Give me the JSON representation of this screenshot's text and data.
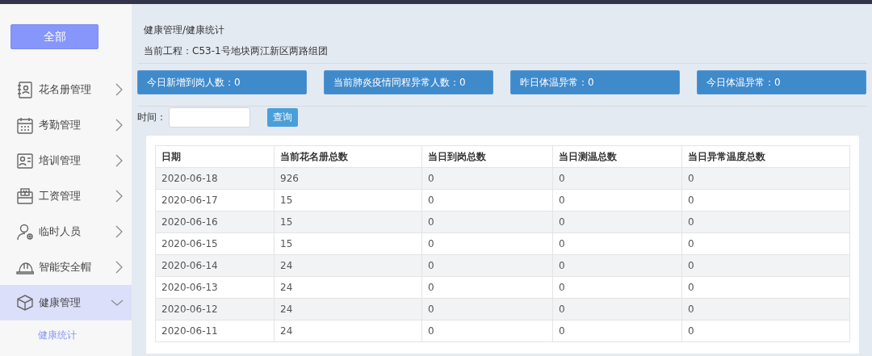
{
  "sidebar": {
    "all_button": "全部",
    "items": [
      {
        "label": "花名册管理",
        "expanded": false,
        "selected": false
      },
      {
        "label": "考勤管理",
        "expanded": false,
        "selected": false
      },
      {
        "label": "培训管理",
        "expanded": false,
        "selected": false
      },
      {
        "label": "工资管理",
        "expanded": false,
        "selected": false
      },
      {
        "label": "临时人员",
        "expanded": false,
        "selected": false
      },
      {
        "label": "智能安全帽",
        "expanded": false,
        "selected": false
      },
      {
        "label": "健康管理",
        "expanded": true,
        "selected": true,
        "children": [
          {
            "label": "健康统计",
            "selected": true
          }
        ]
      }
    ]
  },
  "breadcrumb": "健康管理/健康统计",
  "project": "当前工程：C53-1号地块两江新区两路组团",
  "stats": [
    "今日新增到岗人数：0",
    "当前肺炎疫情同程异常人数：0",
    "昨日体温异常：0",
    "今日体温异常：0"
  ],
  "filter": {
    "label": "时间：",
    "button": "查询"
  },
  "table": {
    "columns": [
      "日期",
      "当前花名册总数",
      "当日到岗总数",
      "当日测温总数",
      "当日异常温度总数"
    ],
    "rows": [
      [
        "2020-06-18",
        "926",
        "0",
        "0",
        "0"
      ],
      [
        "2020-06-17",
        "15",
        "0",
        "0",
        "0"
      ],
      [
        "2020-06-16",
        "15",
        "0",
        "0",
        "0"
      ],
      [
        "2020-06-15",
        "15",
        "0",
        "0",
        "0"
      ],
      [
        "2020-06-14",
        "24",
        "0",
        "0",
        "0"
      ],
      [
        "2020-06-13",
        "24",
        "0",
        "0",
        "0"
      ],
      [
        "2020-06-12",
        "24",
        "0",
        "0",
        "0"
      ],
      [
        "2020-06-11",
        "24",
        "0",
        "0",
        "0"
      ]
    ]
  }
}
